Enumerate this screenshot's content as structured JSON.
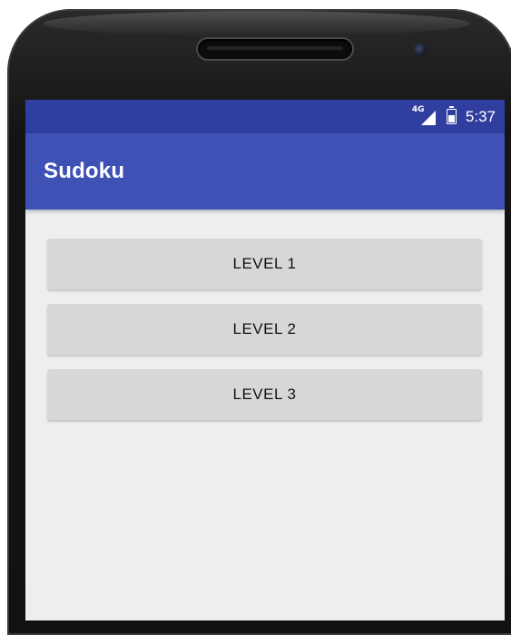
{
  "status_bar": {
    "network": "4G",
    "time": "5:37"
  },
  "app_bar": {
    "title": "Sudoku"
  },
  "levels": [
    {
      "label": "LEVEL 1"
    },
    {
      "label": "LEVEL 2"
    },
    {
      "label": "LEVEL 3"
    }
  ],
  "colors": {
    "status_bar": "#303f9f",
    "app_bar": "#3f51b5",
    "background": "#eeeeee",
    "button": "#d6d7d7"
  },
  "icons": [
    "signal-icon",
    "battery-icon"
  ]
}
